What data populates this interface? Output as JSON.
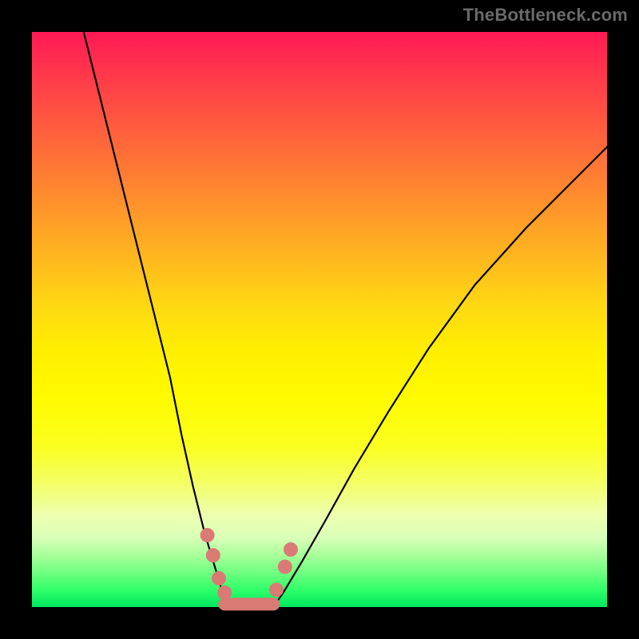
{
  "watermark": "TheBottleneck.com",
  "chart_data": {
    "type": "line",
    "title": "",
    "xlabel": "",
    "ylabel": "",
    "xlim": [
      0,
      100
    ],
    "ylim": [
      0,
      100
    ],
    "grid": false,
    "gradient_stops": [
      {
        "pct": 0,
        "color": "#ff1a55"
      },
      {
        "pct": 50,
        "color": "#ffee00"
      },
      {
        "pct": 88,
        "color": "#f0ffcc"
      },
      {
        "pct": 100,
        "color": "#00e860"
      }
    ],
    "series": [
      {
        "name": "left-branch",
        "x": [
          9,
          12,
          15,
          18,
          21,
          24,
          26,
          28,
          30,
          31.5,
          33,
          34.5
        ],
        "y": [
          100,
          88,
          76,
          64,
          52,
          40,
          30,
          21,
          13,
          8,
          3,
          0
        ]
      },
      {
        "name": "right-branch",
        "x": [
          42,
          44,
          47,
          51,
          56,
          62,
          69,
          77,
          86,
          95,
          100
        ],
        "y": [
          0,
          3,
          8,
          15,
          24,
          34,
          45,
          56,
          66,
          75,
          80
        ]
      }
    ],
    "markers": {
      "color": "#d97a74",
      "points": [
        {
          "x": 30.5,
          "y": 12.5
        },
        {
          "x": 31.5,
          "y": 9
        },
        {
          "x": 32.5,
          "y": 5
        },
        {
          "x": 33.5,
          "y": 2.5
        },
        {
          "x": 42.5,
          "y": 3
        },
        {
          "x": 44,
          "y": 7
        },
        {
          "x": 45,
          "y": 10
        }
      ],
      "floor_run": {
        "x_start": 33.5,
        "x_end": 42,
        "y": 0.5
      }
    }
  }
}
